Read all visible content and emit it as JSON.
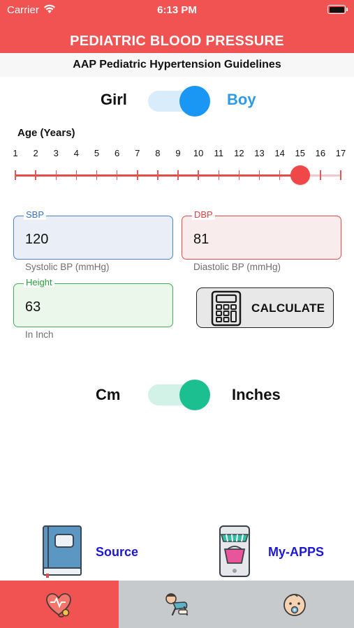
{
  "status_bar": {
    "carrier": "Carrier",
    "time": "6:13 PM"
  },
  "header": {
    "title": "PEDIATRIC BLOOD PRESSURE"
  },
  "subtitle": "AAP Pediatric Hypertension Guidelines",
  "gender_toggle": {
    "left_label": "Girl",
    "right_label": "Boy",
    "selected": "Boy"
  },
  "age_slider": {
    "label": "Age (Years)",
    "ticks": [
      "1",
      "2",
      "3",
      "4",
      "5",
      "6",
      "7",
      "8",
      "9",
      "10",
      "11",
      "12",
      "13",
      "14",
      "15",
      "16",
      "17"
    ],
    "min": 1,
    "max": 17,
    "value": 15
  },
  "sbp": {
    "legend": "SBP",
    "value": "120",
    "helper": "Systolic BP (mmHg)"
  },
  "dbp": {
    "legend": "DBP",
    "value": "81",
    "helper": "Diastolic BP (mmHg)"
  },
  "height": {
    "legend": "Height",
    "value": "63",
    "helper": "In Inch"
  },
  "calculate_button": {
    "label": "CALCULATE"
  },
  "unit_toggle": {
    "left_label": "Cm",
    "right_label": "Inches",
    "selected": "Inches"
  },
  "links": {
    "source": "Source",
    "my_apps": "My-APPS"
  },
  "tabs": [
    {
      "icon": "heart-stethoscope-icon",
      "active": true
    },
    {
      "icon": "crawling-baby-icon",
      "active": false
    },
    {
      "icon": "baby-face-icon",
      "active": false
    }
  ],
  "colors": {
    "brand_red": "#f15252",
    "boy_blue": "#2e9be6",
    "unit_green": "#1cbf8f",
    "link_blue": "#1d17d6",
    "tabbar_gray": "#c7cacd"
  }
}
